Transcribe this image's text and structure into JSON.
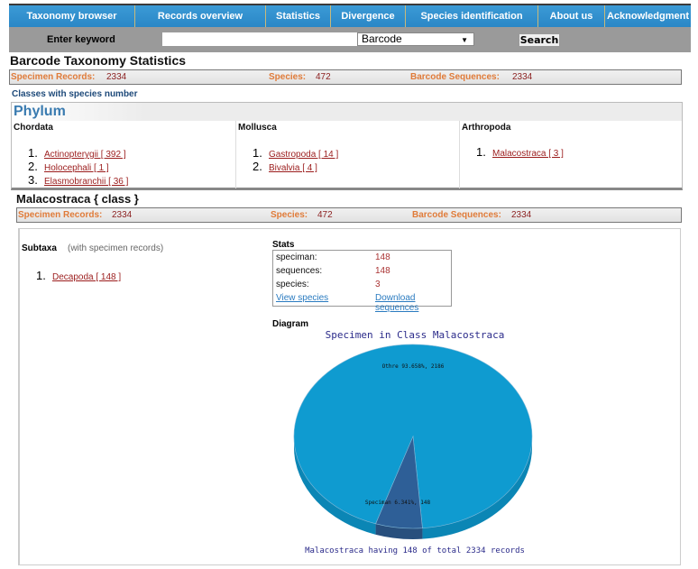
{
  "nav": {
    "items": [
      {
        "label": "Taxonomy browser"
      },
      {
        "label": "Records overview"
      },
      {
        "label": "Statistics"
      },
      {
        "label": "Divergence"
      },
      {
        "label": "Species identification"
      },
      {
        "label": "About us"
      },
      {
        "label": "Acknowledgment"
      }
    ]
  },
  "search": {
    "label": "Enter keyword",
    "value": "",
    "placeholder": "",
    "selected_option": "Barcode",
    "button_label": "Search"
  },
  "page_title": "Barcode Taxonomy Statistics",
  "summary": {
    "specimen_records_label": "Specimen Records:",
    "specimen_records": "2334",
    "species_label": "Species:",
    "species": "472",
    "barcode_sequences_label": "Barcode Sequences:",
    "barcode_sequences": "2334"
  },
  "classes_title": "Classes with species number",
  "phylum": {
    "title": "Phylum",
    "columns": [
      {
        "name": "Chordata",
        "items": [
          {
            "num": "1.",
            "label": "Actinopterygii [ 392 ]"
          },
          {
            "num": "2.",
            "label": "Holocephali [ 1 ]"
          },
          {
            "num": "3.",
            "label": "Elasmobranchii [ 36 ]"
          }
        ]
      },
      {
        "name": "Mollusca",
        "items": [
          {
            "num": "1.",
            "label": "Gastropoda [ 14 ]"
          },
          {
            "num": "2.",
            "label": "Bivalvia [ 4 ]"
          }
        ]
      },
      {
        "name": "Arthropoda",
        "items": [
          {
            "num": "1.",
            "label": "Malacostraca [ 3 ]"
          }
        ]
      }
    ]
  },
  "class_section": {
    "title": "Malacostraca { class }",
    "summary": {
      "specimen_records_label": "Specimen Records:",
      "specimen_records": "2334",
      "species_label": "Species:",
      "species": "472",
      "barcode_sequences_label": "Barcode Sequences:",
      "barcode_sequences": "2334"
    },
    "subtaxa": {
      "title": "Subtaxa",
      "note": "(with specimen records)",
      "items": [
        {
          "num": "1.",
          "label": "Decapoda [ 148 ]"
        }
      ]
    },
    "stats": {
      "title": "Stats",
      "rows": [
        {
          "key": "speciman:",
          "value": "148"
        },
        {
          "key": "sequences:",
          "value": "148"
        },
        {
          "key": "species:",
          "value": "3"
        }
      ],
      "view_species_label": "View species",
      "download_label": "Download sequences"
    },
    "diagram_title": "Diagram"
  },
  "colors": {
    "nav_blue": "#2f8fcf",
    "pie_others": "#0f9bd0",
    "pie_specimen": "#2e5f97",
    "label_orange": "#e07b39",
    "value_red": "#8b1f1f",
    "chart_text": "#2b2b8a"
  },
  "chart_data": {
    "type": "pie",
    "title": "Specimen in Class Malacostraca",
    "caption": "Malacostraca having 148 of total 2334 records",
    "slices": [
      {
        "name": "Othre",
        "value": 2186,
        "percent": 93.658,
        "label": "Othre 93.658%, 2186"
      },
      {
        "name": "Speciman",
        "value": 148,
        "percent": 6.341,
        "label": "Speciman 6.341%, 148"
      }
    ],
    "total": 2334,
    "style": "3d"
  }
}
